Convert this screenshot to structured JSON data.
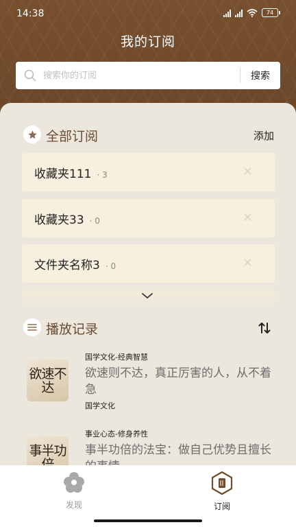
{
  "status_bar": {
    "time": "14:38",
    "battery": "74"
  },
  "header": {
    "title": "我的订阅",
    "search": {
      "placeholder": "搜索你的订阅",
      "button_label": "搜索"
    }
  },
  "subscriptions": {
    "title": "全部订阅",
    "action_label": "添加",
    "folders": [
      {
        "name": "收藏夹111",
        "count": "· 3"
      },
      {
        "name": "收藏夹33",
        "count": "· 0"
      },
      {
        "name": "文件夹名称3",
        "count": "· 0"
      }
    ],
    "close_glyph": "×"
  },
  "history": {
    "title": "播放记录",
    "items": [
      {
        "category": "国学文化-经典智慧",
        "title": "欲速则不达，真正厉害的人，从不着急",
        "tag": "国学文化",
        "thumb_text": "欲速不达"
      },
      {
        "category": "事业心态-修身养性",
        "title": "事半功倍的法宝：做自己优势且擅长的事情",
        "tag": "",
        "thumb_text": "事半功倍"
      }
    ]
  },
  "tab_bar": {
    "tabs": [
      {
        "label": "发现",
        "active": false
      },
      {
        "label": "订阅",
        "active": true
      }
    ]
  },
  "colors": {
    "header_brown": "#6e4a2c",
    "section_title": "#6a4a33",
    "folder_bg": "#f7f0de",
    "sheet_bg": "#ece7dc",
    "tab_inactive": "#9a9a9a",
    "tab_active": "#222222"
  }
}
